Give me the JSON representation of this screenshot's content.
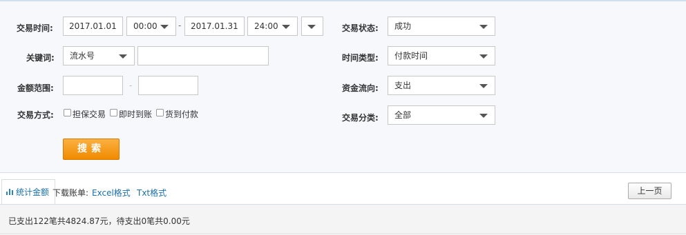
{
  "filters": {
    "trade_time_label": "交易时间:",
    "start_date": "2017.01.01",
    "start_time": "00:00",
    "range_dash": "-",
    "end_date": "2017.01.31",
    "end_time": "24:00",
    "keyword_label": "关键词:",
    "keyword_type": "流水号",
    "keyword_value": "",
    "amount_label": "金额范围:",
    "amount_min": "",
    "amount_dash": "-",
    "amount_max": "",
    "method_label": "交易方式:",
    "methods": [
      "担保交易",
      "即时到账",
      "货到付款"
    ],
    "status_label": "交易状态:",
    "status_value": "成功",
    "time_type_label": "时间类型:",
    "time_type_value": "付款时间",
    "flow_label": "资金流向:",
    "flow_value": "支出",
    "category_label": "交易分类:",
    "category_value": "全部",
    "search_label": "搜索"
  },
  "toolbar": {
    "stats_tab": "统计金额",
    "download_label": "下载账单:",
    "excel_link": "Excel格式",
    "txt_link": "Txt格式",
    "prev_page": "上一页"
  },
  "summary": {
    "text": "已支出122笔共4824.87元，待支出0笔共0.00元"
  },
  "colors": {
    "accent_orange": "#f39200",
    "link_blue": "#1a6fa8",
    "panel_bg": "#f7f8fc"
  }
}
